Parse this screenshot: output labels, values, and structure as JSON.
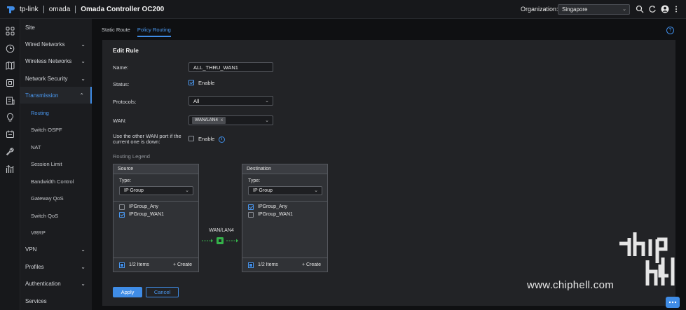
{
  "topbar": {
    "brand_name": "tp-link",
    "product": "omada",
    "controller_title": "Omada Controller OC200",
    "org_label": "Organization:",
    "org_value": "Singapore",
    "icons": [
      "search-icon",
      "refresh-icon",
      "avatar-icon",
      "more-icon"
    ]
  },
  "rail_icons": [
    "site-grid-icon",
    "clock-icon",
    "map-icon",
    "device-icon",
    "report-icon",
    "lightbulb-icon",
    "log-icon",
    "tools-icon",
    "stats-icon"
  ],
  "nav": {
    "items": [
      {
        "label": "Site",
        "caret": ""
      },
      {
        "label": "Wired Networks",
        "caret": "⌄"
      },
      {
        "label": "Wireless Networks",
        "caret": "⌄"
      },
      {
        "label": "Network Security",
        "caret": "⌄"
      },
      {
        "label": "Transmission",
        "caret": "⌃"
      }
    ],
    "sub_items": [
      "Routing",
      "Switch OSPF",
      "NAT",
      "Session Limit",
      "Bandwidth Control",
      "Gateway QoS",
      "Switch QoS",
      "VRRP"
    ],
    "bottom_items": [
      {
        "label": "VPN",
        "caret": "⌄"
      },
      {
        "label": "Profiles",
        "caret": "⌄"
      },
      {
        "label": "Authentication",
        "caret": "⌄"
      },
      {
        "label": "Services",
        "caret": ""
      }
    ]
  },
  "tabs": [
    "Static Route",
    "Policy Routing"
  ],
  "help_icon": "?",
  "form": {
    "title": "Edit Rule",
    "name_label": "Name:",
    "name_value": "ALL_THRU_WAN1",
    "status_label": "Status:",
    "status_option": "Enable",
    "protocols_label": "Protocols:",
    "protocols_value": "All",
    "wan_label": "WAN:",
    "wan_tag": "WAN/LAN4",
    "wan_tag_remove": "x",
    "failover_label_1": "Use the other WAN port if the",
    "failover_label_2": "current one is down:",
    "failover_option": "Enable",
    "legend_title": "Routing Legend"
  },
  "legend": {
    "source": {
      "title": "Source",
      "type_label": "Type:",
      "type_value": "IP Group",
      "options": [
        {
          "label": "IPGroup_Any",
          "checked": false
        },
        {
          "label": "IPGroup_WAN1",
          "checked": true
        }
      ],
      "count": "1/2 Items",
      "create": "+ Create"
    },
    "destination": {
      "title": "Destination",
      "type_label": "Type:",
      "type_value": "IP Group",
      "options": [
        {
          "label": "IPGroup_Any",
          "checked": true
        },
        {
          "label": "IPGroup_WAN1",
          "checked": false
        }
      ],
      "count": "1/2 Items",
      "create": "+ Create"
    },
    "path_label": "WAN/LAN4"
  },
  "actions": {
    "apply": "Apply",
    "cancel": "Cancel"
  },
  "watermark": "www.chiphell.com",
  "colors": {
    "accent": "#3f8ce6",
    "path_green": "#35b24a"
  }
}
